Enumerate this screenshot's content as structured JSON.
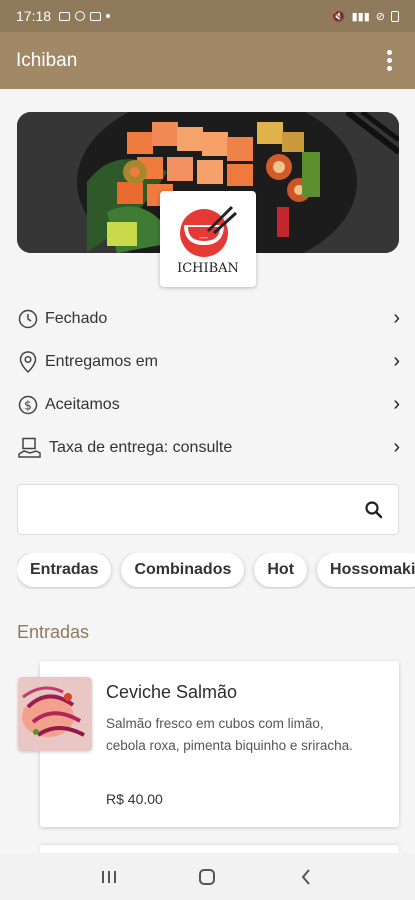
{
  "status_bar": {
    "time": "17:18"
  },
  "app_bar": {
    "title": "Ichiban",
    "menu_icon": "more-vert-icon"
  },
  "brand": {
    "logo_text": "ICHIBAN"
  },
  "info": [
    {
      "icon": "clock-icon",
      "label": "Fechado"
    },
    {
      "icon": "location-pin-icon",
      "label": "Entregamos em"
    },
    {
      "icon": "dollar-circle-icon",
      "label": "Aceitamos"
    },
    {
      "icon": "delivery-hand-icon",
      "label": "Taxa de entrega: consulte"
    }
  ],
  "search": {
    "placeholder": ""
  },
  "categories": [
    "Entradas",
    "Combinados",
    "Hot",
    "Hossomaki"
  ],
  "section": {
    "title": "Entradas"
  },
  "items": [
    {
      "name": "Ceviche Salmão",
      "description": "Salmão fresco em cubos com limão, cebola roxa, pimenta biquinho e sriracha.",
      "price": "R$ 40.00"
    }
  ],
  "colors": {
    "primary": "#a18866",
    "status_bar": "#8f7a5b",
    "accent_red": "#e53935"
  }
}
